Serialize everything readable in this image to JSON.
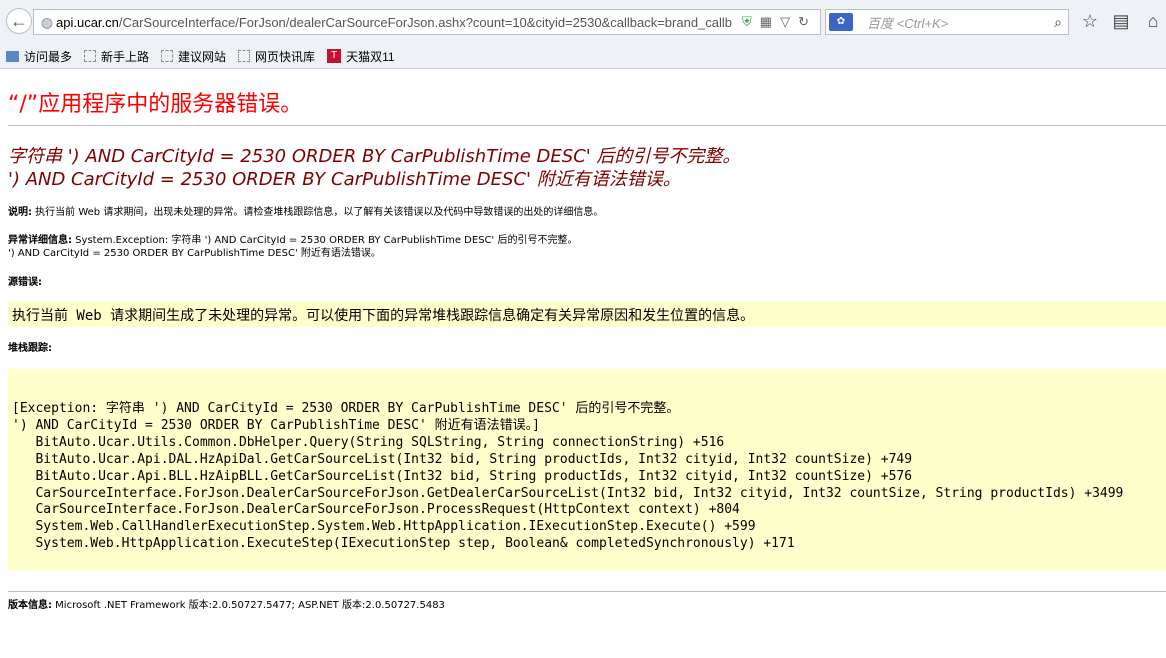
{
  "browser": {
    "url_domain": "api.ucar.cn",
    "url_path": "/CarSourceInterface/ForJson/dealerCarSourceForJson.ashx?count=10&cityid=2530&callback=brand_callb",
    "search_engine": "百度",
    "search_placeholder": "百度 <Ctrl+K>"
  },
  "bookmarks": [
    {
      "label": "访问最多"
    },
    {
      "label": "新手上路"
    },
    {
      "label": "建议网站"
    },
    {
      "label": "网页快讯库"
    },
    {
      "label": "天猫双11"
    }
  ],
  "page": {
    "title": "“/”应用程序中的服务器错误。",
    "error_line1": "字符串 ') AND CarCityId = 2530 ORDER BY CarPublishTime DESC' 后的引号不完整。",
    "error_line2": "') AND CarCityId = 2530 ORDER BY CarPublishTime DESC' 附近有语法错误。",
    "desc_label": "说明:",
    "desc_text": " 执行当前 Web 请求期间，出现未处理的异常。请检查堆栈跟踪信息，以了解有关该错误以及代码中导致错误的出处的详细信息。",
    "exception_label": "异常详细信息:",
    "exception_text": " System.Exception: 字符串 ') AND CarCityId = 2530 ORDER BY CarPublishTime DESC' 后的引号不完整。",
    "exception_text2": "') AND CarCityId = 2530 ORDER BY CarPublishTime DESC' 附近有语法错误。",
    "source_label": "源错误:",
    "source_text": "执行当前 Web 请求期间生成了未处理的异常。可以使用下面的异常堆栈跟踪信息确定有关异常原因和发生位置的信息。",
    "stack_label": "堆栈跟踪:",
    "stack_trace": "[Exception: 字符串 ') AND CarCityId = 2530 ORDER BY CarPublishTime DESC' 后的引号不完整。\n') AND CarCityId = 2530 ORDER BY CarPublishTime DESC' 附近有语法错误。]\n   BitAuto.Ucar.Utils.Common.DbHelper.Query(String SQLString, String connectionString) +516\n   BitAuto.Ucar.Api.DAL.HzApiDal.GetCarSourceList(Int32 bid, String productIds, Int32 cityid, Int32 countSize) +749\n   BitAuto.Ucar.Api.BLL.HzAipBLL.GetCarSourceList(Int32 bid, String productIds, Int32 cityid, Int32 countSize) +576\n   CarSourceInterface.ForJson.DealerCarSourceForJson.GetDealerCarSourceList(Int32 bid, Int32 cityid, Int32 countSize, String productIds) +3499\n   CarSourceInterface.ForJson.DealerCarSourceForJson.ProcessRequest(HttpContext context) +804\n   System.Web.CallHandlerExecutionStep.System.Web.HttpApplication.IExecutionStep.Execute() +599\n   System.Web.HttpApplication.ExecuteStep(IExecutionStep step, Boolean& completedSynchronously) +171",
    "version_label": "版本信息:",
    "version_text": " Microsoft .NET Framework 版本:2.0.50727.5477; ASP.NET 版本:2.0.50727.5483"
  },
  "colors": {
    "title_red": "#ff0000",
    "error_maroon": "#800000",
    "highlight_yellow": "#ffffcc"
  }
}
